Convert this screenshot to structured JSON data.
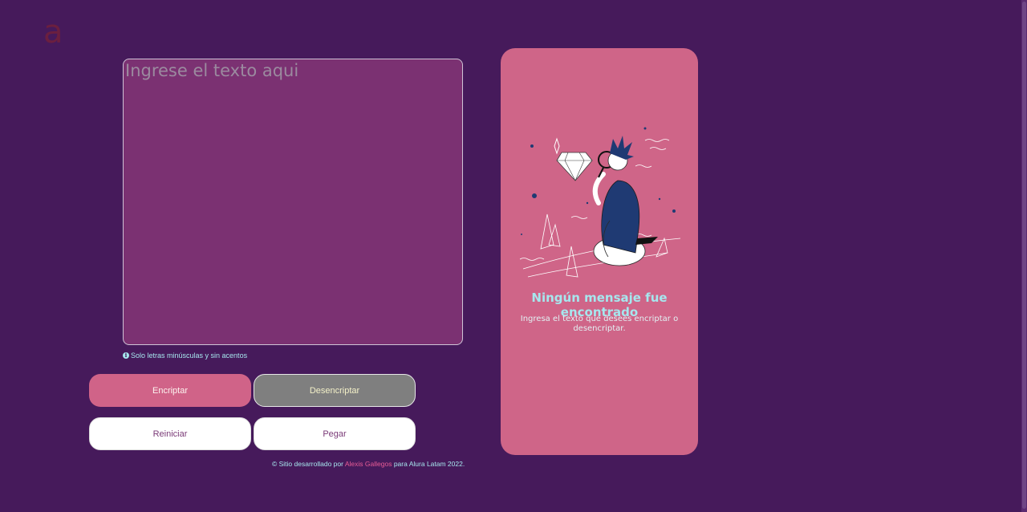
{
  "logo": {
    "text": "a"
  },
  "input": {
    "placeholder": "Ingrese el texto aqui",
    "value": ""
  },
  "hint": {
    "text": "Solo letras minúsculas y sin acentos"
  },
  "buttons": {
    "encrypt": "Encriptar",
    "decrypt": "Desencriptar",
    "reset": "Reiniciar",
    "paste": "Pegar"
  },
  "footer": {
    "prefix": "© Sitio desarrollado por",
    "author": "Alexis Gallegos",
    "suffix": "para Alura Latam 2022."
  },
  "output": {
    "title": "Ningún mensaje fue encontrado",
    "text": "Ingresa el texto que desees encriptar o desencriptar."
  },
  "colors": {
    "background": "#461a5b",
    "textarea": "#7b3172",
    "panel": "#cf6588",
    "accent_cyan": "#a6e7ee",
    "encrypt_button": "#d06388",
    "decrypt_button": "#7f7f7f",
    "author_link": "#e85c96"
  },
  "icons": {
    "hint": "info-icon",
    "illustration": "person-with-magnifying-glass-and-diamond"
  }
}
